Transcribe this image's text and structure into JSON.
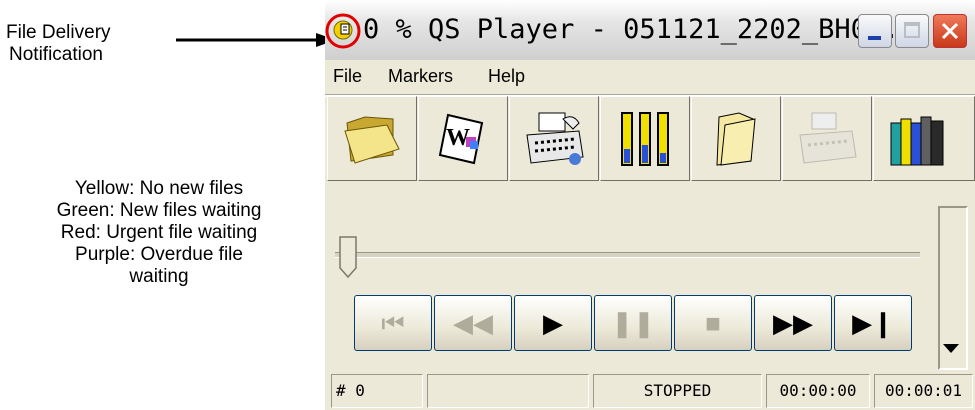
{
  "annotation": {
    "title_line1": "File Delivery",
    "title_line2": "Notification",
    "legend": [
      "Yellow: No new files",
      "Green:  New files waiting",
      "Red:  Urgent file waiting",
      "Purple: Overdue file",
      "waiting"
    ]
  },
  "window": {
    "title": "0 % QS Player - 051121_2202_BH0...",
    "notification_color": "#f2d000",
    "highlight_color": "#e00000"
  },
  "menu": [
    "File",
    "Markers",
    "Help"
  ],
  "toolbar_icons": [
    "open-folder-icon",
    "word-document-icon",
    "typewriter-icon",
    "levels-icon",
    "folder-icon",
    "disabled-typewriter-icon",
    "books-icon"
  ],
  "transport": {
    "buttons": [
      {
        "name": "skip-to-start",
        "glyph": "⏮",
        "enabled": false
      },
      {
        "name": "rewind",
        "glyph": "◀◀",
        "enabled": false
      },
      {
        "name": "play",
        "glyph": "▶",
        "enabled": true
      },
      {
        "name": "pause",
        "glyph": "❚❚",
        "enabled": false
      },
      {
        "name": "stop",
        "glyph": "■",
        "enabled": false
      },
      {
        "name": "fast-forward",
        "glyph": "▶▶",
        "enabled": true
      },
      {
        "name": "skip-to-end",
        "glyph": "▶❙",
        "enabled": true
      }
    ]
  },
  "status": {
    "marker": "# 0",
    "blank": "",
    "state": "STOPPED",
    "position": "00:00:00",
    "length": "00:00:01"
  }
}
